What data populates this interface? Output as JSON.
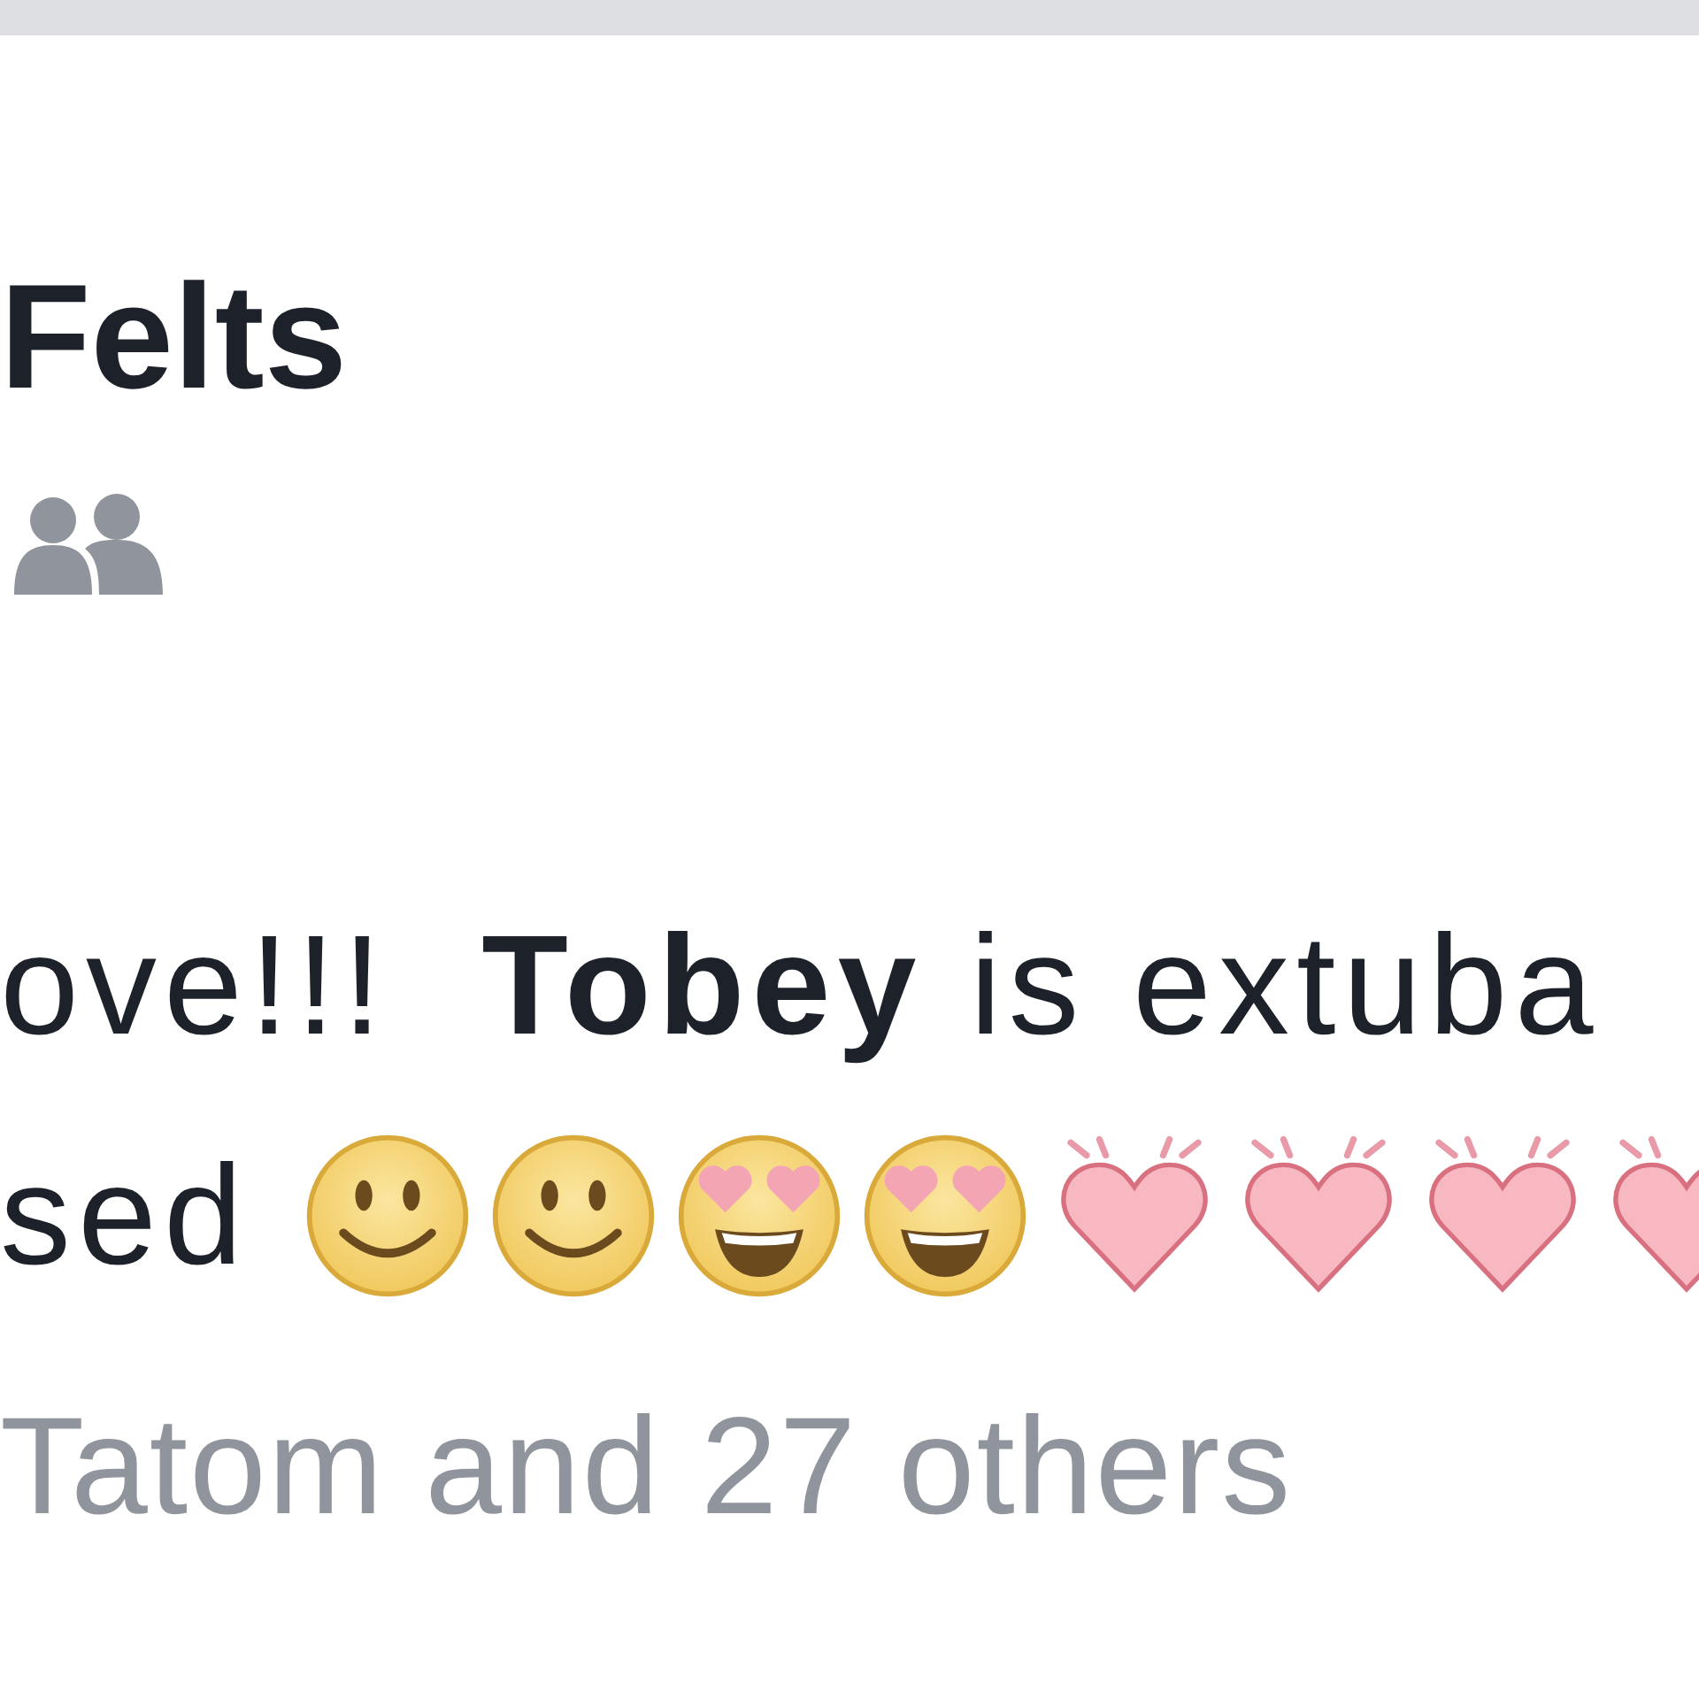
{
  "post": {
    "author": "Felts",
    "audience": {
      "kind": "friends"
    },
    "lines": [
      "ove!!!  **Tobey** is extuba",
      "sed"
    ],
    "emojis": [
      {
        "kind": "smile"
      },
      {
        "kind": "smile"
      },
      {
        "kind": "heart_eyes"
      },
      {
        "kind": "heart_eyes"
      },
      {
        "kind": "beating_heart"
      },
      {
        "kind": "beating_heart"
      },
      {
        "kind": "beating_heart"
      },
      {
        "kind": "beating_heart"
      }
    ],
    "reactions": "Tatom and 27 others"
  }
}
